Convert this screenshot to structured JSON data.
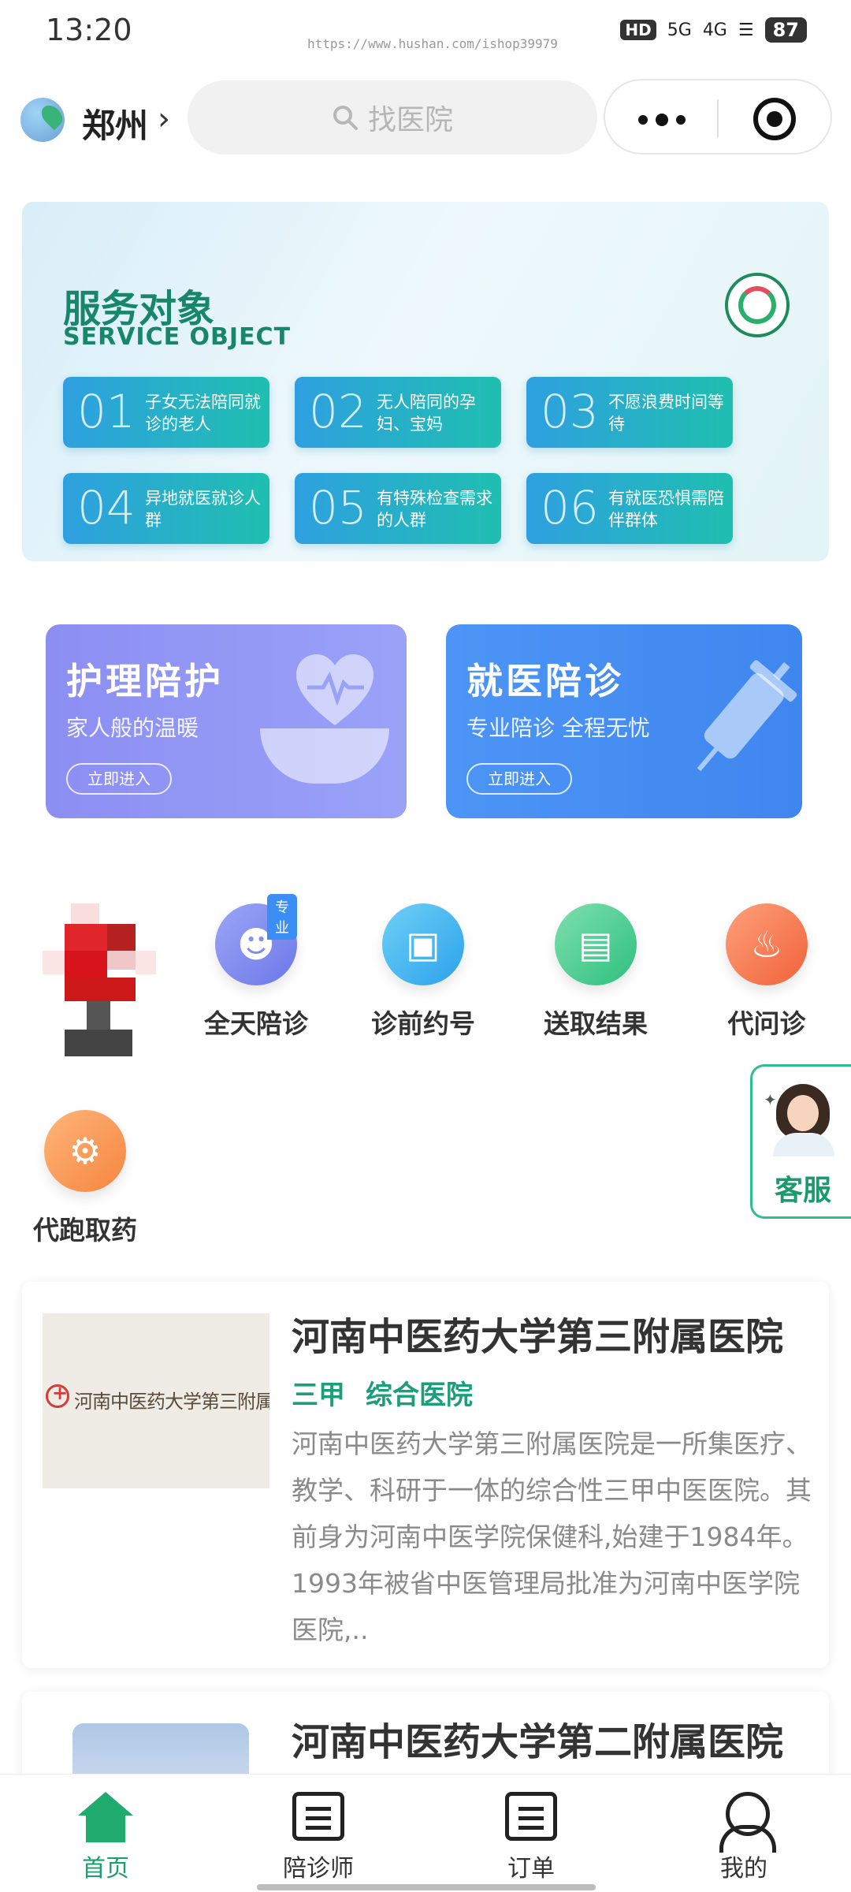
{
  "status_bar": {
    "time": "13:20",
    "url": "https://www.hushan.com/ishop39979",
    "signal_hd": "HD",
    "signal_5g": "5G",
    "signal_4g": "4G",
    "battery": "87"
  },
  "header": {
    "city": "郑州",
    "search_placeholder": "找医院"
  },
  "banner": {
    "title": "服务对象",
    "subtitle": "SERVICE OBJECT",
    "items": [
      {
        "num": "01",
        "text": "子女无法陪同就诊的老人"
      },
      {
        "num": "02",
        "text": "无人陪同的孕妇、宝妈"
      },
      {
        "num": "03",
        "text": "不愿浪费时间等待"
      },
      {
        "num": "04",
        "text": "异地就医就诊人群"
      },
      {
        "num": "05",
        "text": "有特殊检查需求的人群"
      },
      {
        "num": "06",
        "text": "有就医恐惧需陪伴群体"
      }
    ]
  },
  "cards": [
    {
      "title": "护理陪护",
      "subtitle": "家人般的温暖",
      "button": "立即进入"
    },
    {
      "title": "就医陪诊",
      "subtitle": "专业陪诊 全程无忧",
      "button": "立即进入"
    }
  ],
  "services": [
    {
      "label": "全天陪诊",
      "badge": "专业",
      "color": "#7a86f0"
    },
    {
      "label": "诊前约号",
      "color": "#3fb0f0"
    },
    {
      "label": "送取结果",
      "color": "#3ecb8e"
    },
    {
      "label": "代问诊",
      "color": "#f47a4a"
    },
    {
      "label": "代跑取药",
      "color": "#f69a4a"
    }
  ],
  "customer_service": {
    "label": "客服"
  },
  "hospitals": [
    {
      "name": "河南中医药大学第三附属医院",
      "tags": [
        "三甲",
        "综合医院"
      ],
      "thumb_text": "河南中医药大学第三附属医",
      "description": "河南中医药大学第三附属医院是一所集医疗、教学、科研于一体的综合性三甲中医医院。其前身为河南中医学院保健科,始建于1984年。1993年被省中医管理局批准为河南中医学院医院,.."
    },
    {
      "name": "河南中医药大学第二附属医院"
    }
  ],
  "tabbar": {
    "items": [
      {
        "label": "首页"
      },
      {
        "label": "陪诊师"
      },
      {
        "label": "订单"
      },
      {
        "label": "我的"
      }
    ]
  }
}
